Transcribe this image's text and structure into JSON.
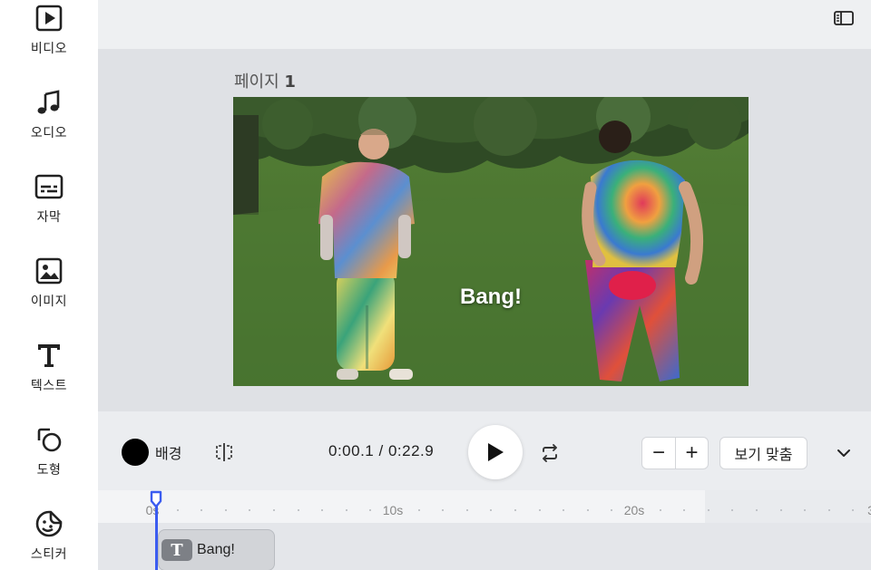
{
  "sidebar": {
    "items": [
      {
        "label": "비디오",
        "icon": "video-icon"
      },
      {
        "label": "오디오",
        "icon": "music-note-icon"
      },
      {
        "label": "자막",
        "icon": "subtitles-icon"
      },
      {
        "label": "이미지",
        "icon": "image-icon"
      },
      {
        "label": "텍스트",
        "icon": "text-icon"
      },
      {
        "label": "도형",
        "icon": "shapes-icon"
      },
      {
        "label": "스티커",
        "icon": "sticker-icon"
      }
    ]
  },
  "topbar": {
    "panel_toggle_icon": "panel-toggle-icon"
  },
  "canvas": {
    "page_title": "페이지",
    "page_number": "1",
    "caption": "Bang!"
  },
  "controls": {
    "background_label": "배경",
    "background_color": "#000000",
    "current_time": "0:00.1",
    "separator": "/",
    "total_time": "0:22.9",
    "zoom_out_label": "−",
    "zoom_in_label": "+",
    "fit_label": "보기 맞춤"
  },
  "timeline": {
    "tick_labels": [
      "0s",
      "10s",
      "20s",
      "3"
    ],
    "clips": [
      {
        "label": "Bang!",
        "icon_glyph": "T"
      }
    ]
  },
  "colors": {
    "accent": "#3b5cf0",
    "caption_text": "#ffffff"
  }
}
